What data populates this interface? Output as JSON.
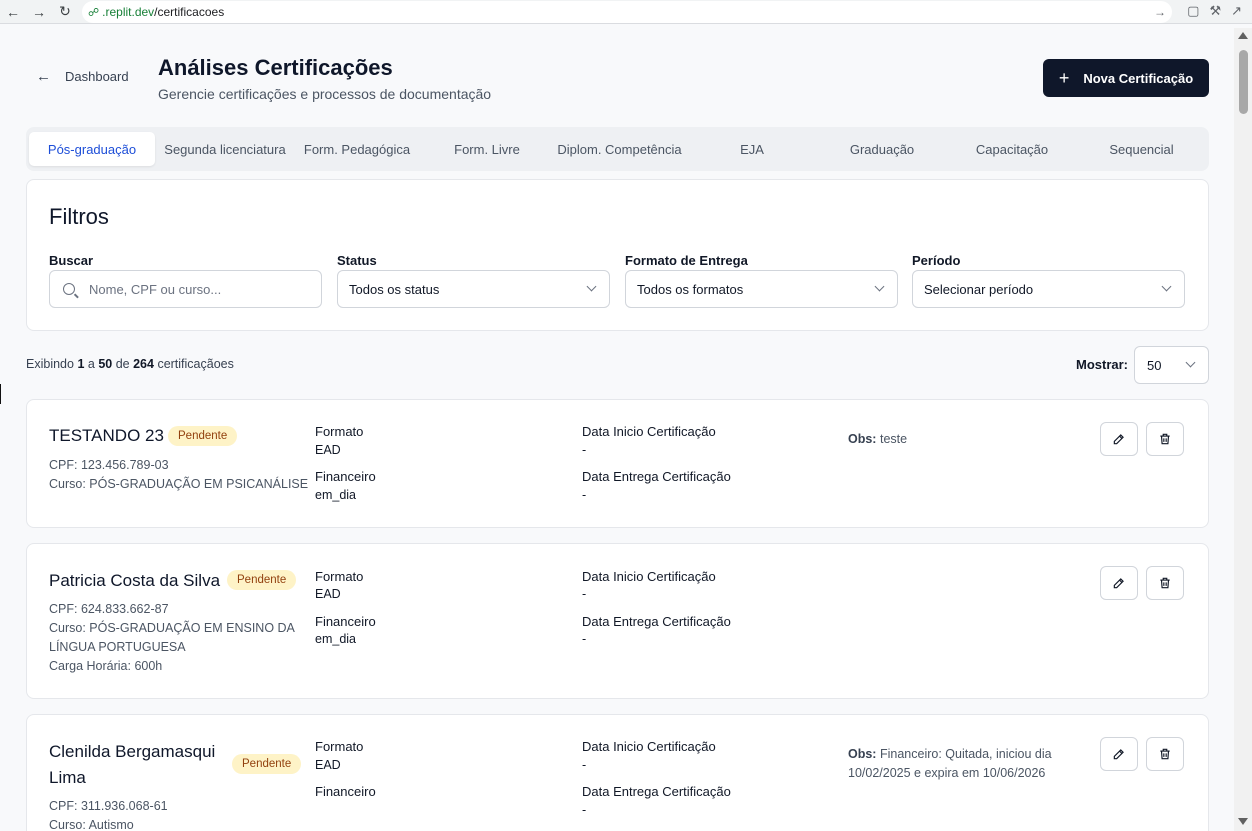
{
  "browser": {
    "url_host": ".replit.dev",
    "url_path": "/certificacoes"
  },
  "header": {
    "back_label": "Dashboard",
    "title": "Análises Certificações",
    "subtitle": "Gerencie certificações e processos de documentação",
    "new_button_label": "Nova Certificação"
  },
  "tabs": [
    {
      "label": "Pós-graduação",
      "active": true
    },
    {
      "label": "Segunda licenciatura"
    },
    {
      "label": "Form. Pedagógica"
    },
    {
      "label": "Form. Livre"
    },
    {
      "label": "Diplom. Competência"
    },
    {
      "label": "EJA"
    },
    {
      "label": "Graduação"
    },
    {
      "label": "Capacitação"
    },
    {
      "label": "Sequencial"
    }
  ],
  "filters": {
    "title": "Filtros",
    "search_label": "Buscar",
    "search_placeholder": "Nome, CPF ou curso...",
    "status_label": "Status",
    "status_value": "Todos os status",
    "format_label": "Formato de Entrega",
    "format_value": "Todos os formatos",
    "period_label": "Período",
    "period_value": "Selecionar período"
  },
  "results": {
    "prefix": "Exibindo",
    "from": "1",
    "to_word": "a",
    "to": "50",
    "of_word": "de",
    "total": "264",
    "suffix": "certificaçãoes",
    "show_label": "Mostrar:",
    "show_value": "50"
  },
  "labels": {
    "formato": "Formato",
    "financeiro": "Financeiro",
    "data_inicio": "Data Inicio Certificação",
    "data_entrega": "Data Entrega Certificação",
    "obs": "Obs:"
  },
  "certifications": [
    {
      "name": "TESTANDO 23",
      "status": "Pendente",
      "cpf": "CPF: 123.456.789-03",
      "curso": "Curso: PÓS-GRADUAÇÃO EM PSICANÁLISE",
      "formato": "EAD",
      "financeiro": "em_dia",
      "data_inicio": "-",
      "data_entrega": "-",
      "obs": "teste"
    },
    {
      "name": "Patricia Costa da Silva",
      "status": "Pendente",
      "cpf": "CPF: 624.833.662-87",
      "curso_line1": "Curso: PÓS-GRADUAÇÃO EM ENSINO DA",
      "curso_line2": "LÍNGUA PORTUGUESA",
      "carga": "Carga Horária: 600h",
      "formato": "EAD",
      "financeiro": "em_dia",
      "data_inicio": "-",
      "data_entrega": "-"
    },
    {
      "name_line1": "Clenilda Bergamasqui",
      "name_line2": "Lima",
      "status": "Pendente",
      "cpf": "CPF: 311.936.068-61",
      "curso": "Curso: Autismo",
      "formato": "EAD",
      "data_inicio": "-",
      "data_entrega": "-",
      "obs_line1": "Financeiro: Quitada, iniciou dia",
      "obs_line2": "10/02/2025 e expira em 10/06/2026"
    }
  ]
}
